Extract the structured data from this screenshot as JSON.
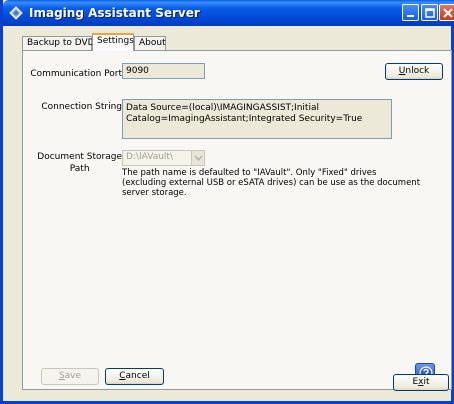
{
  "window": {
    "title": "Imaging Assistant Server",
    "icon": "app-icon"
  },
  "tabs": [
    {
      "label": "Backup to DVD",
      "active": false
    },
    {
      "label": "Settings",
      "active": true
    },
    {
      "label": "About",
      "active": false
    }
  ],
  "settings": {
    "communication_port_label": "Communication Port",
    "communication_port_value": "9090",
    "unlock_button": {
      "mnemonic": "U",
      "rest": "nlock"
    },
    "connection_string_label": "Connection String",
    "connection_string_value": "Data Source=(local)\\IMAGINGASSIST;Initial Catalog=ImagingAssistant;Integrated Security=True",
    "storage_path_label_line1": "Document Storage",
    "storage_path_label_line2": "Path",
    "storage_path_value": "D:\\IAVault\\",
    "storage_path_note": "The path name is defaulted to \"IAVault\".  Only \"Fixed\" drives (excluding external USB or eSATA drives) can be use as the document server storage.",
    "save_button": {
      "mnemonic": "S",
      "rest": "ave"
    },
    "cancel_button": {
      "mnemonic": "C",
      "rest": "ancel"
    }
  },
  "footer": {
    "exit_button": {
      "prefix": "E",
      "mnemonic": "x",
      "rest": "it"
    }
  },
  "colors": {
    "titlebar": "#0054e3",
    "dialog_bg": "#ece9d8",
    "active_tab_accent": "#f3a13a"
  }
}
